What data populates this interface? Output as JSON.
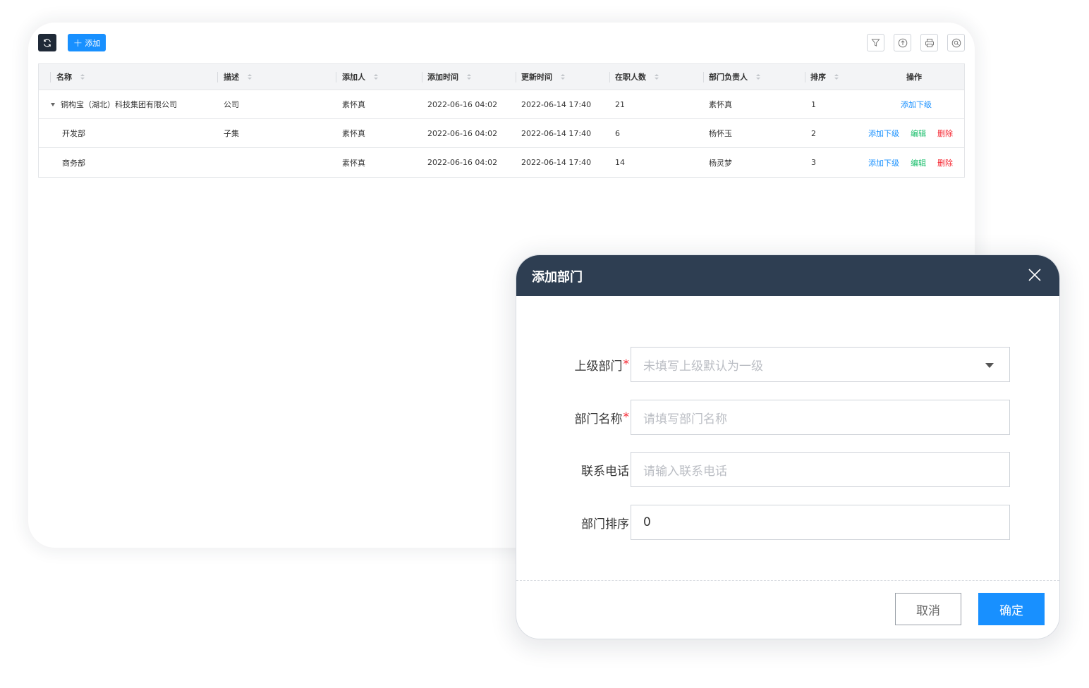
{
  "toolbar": {
    "add_label": "添加",
    "icons": [
      "refresh-icon",
      "filter-icon",
      "export-icon",
      "print-icon",
      "search-icon"
    ]
  },
  "table": {
    "headers": [
      "名称",
      "描述",
      "添加人",
      "添加时间",
      "更新时间",
      "在职人数",
      "部门负责人",
      "排序",
      "操作"
    ],
    "rows": [
      {
        "name": "铜构宝（湖北）科技集团有限公司",
        "desc": "公司",
        "adder": "素怀真",
        "added": "2022-06-16 04:02",
        "updated": "2022-06-14 17:40",
        "staff": "21",
        "leader": "素怀真",
        "order": "1",
        "ops": [
          "添加下级"
        ]
      },
      {
        "name": "开发部",
        "desc": "子集",
        "adder": "素怀真",
        "added": "2022-06-16 04:02",
        "updated": "2022-06-14 17:40",
        "staff": "6",
        "leader": "杨怀玉",
        "order": "2",
        "ops": [
          "添加下级",
          "编辑",
          "删除"
        ]
      },
      {
        "name": "商务部",
        "desc": "",
        "adder": "素怀真",
        "added": "2022-06-16 04:02",
        "updated": "2022-06-14 17:40",
        "staff": "14",
        "leader": "杨灵梦",
        "order": "3",
        "ops": [
          "添加下级",
          "编辑",
          "删除"
        ]
      }
    ]
  },
  "modal": {
    "title": "添加部门",
    "fields": [
      {
        "label": "上级部门",
        "required": "*",
        "placeholder": "未填写上级默认为一级",
        "value": ""
      },
      {
        "label": "部门名称",
        "required": "*",
        "placeholder": "请填写部门名称",
        "value": ""
      },
      {
        "label": "联系电话",
        "required": "",
        "placeholder": "请输入联系电话",
        "value": ""
      },
      {
        "label": "部门排序",
        "required": "",
        "placeholder": "",
        "value": "0"
      }
    ],
    "cancel_label": "取消",
    "ok_label": "确定"
  },
  "colors": {
    "primary": "#1890ff",
    "header_dark": "#2e3e52",
    "success": "#19be6b",
    "danger": "#f5222d"
  }
}
